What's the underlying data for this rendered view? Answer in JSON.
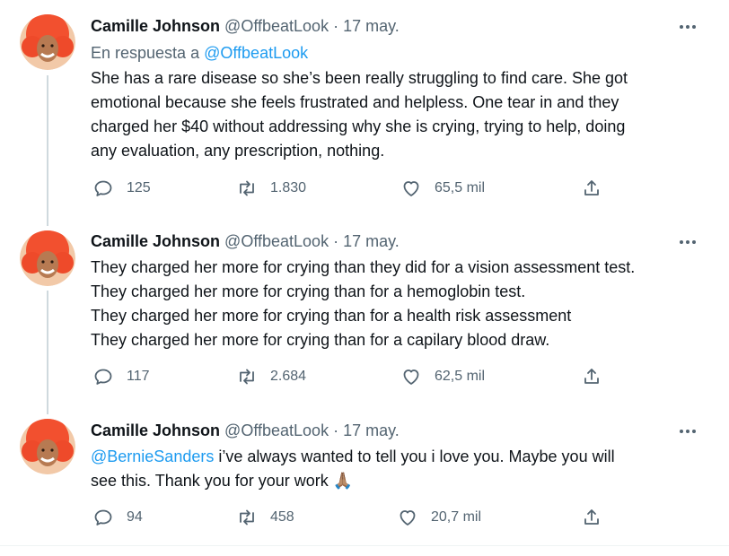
{
  "tweets": [
    {
      "name": "Camille Johnson",
      "handle": "@OffbeatLook",
      "sep": "·",
      "date": "17 may.",
      "reply_prefix": "En respuesta a",
      "reply_handle": "@OffbeatLook",
      "lines": [
        "She has a rare disease so she’s been really struggling to find care. She got",
        "emotional because she feels frustrated and helpless. One tear in and they",
        "charged her $40 without addressing why she is crying, trying to help, doing",
        "any evaluation, any prescription, nothing."
      ],
      "replies": "125",
      "retweets": "1.830",
      "likes": "65,5 mil"
    },
    {
      "name": "Camille Johnson",
      "handle": "@OffbeatLook",
      "sep": "·",
      "date": "17 may.",
      "lines": [
        "They charged her more for crying than they did for a vision assessment test.",
        "They charged her more for crying than for a hemoglobin test.",
        "They charged her more for crying than for a health risk assessment",
        "They charged her more for crying than for a capilary blood draw."
      ],
      "replies": "117",
      "retweets": "2.684",
      "likes": "62,5 mil"
    },
    {
      "name": "Camille Johnson",
      "handle": "@OffbeatLook",
      "sep": "·",
      "date": "17 may.",
      "mention": "@BernieSanders",
      "line1_rest": " i’ve always wanted to tell you i love you. Maybe you will",
      "line2": "see this. Thank you for your work ",
      "emoji": "🙏🏽",
      "replies": "94",
      "retweets": "458",
      "likes": "20,7 mil"
    }
  ],
  "colors": {
    "text": "#0f1419",
    "secondary": "#536471",
    "link": "#1d9bf0",
    "thread_line": "#cfd9de"
  },
  "icons": {
    "reply": "reply-icon",
    "retweet": "retweet-icon",
    "like": "heart-icon",
    "share": "share-icon",
    "more": "more-icon"
  }
}
